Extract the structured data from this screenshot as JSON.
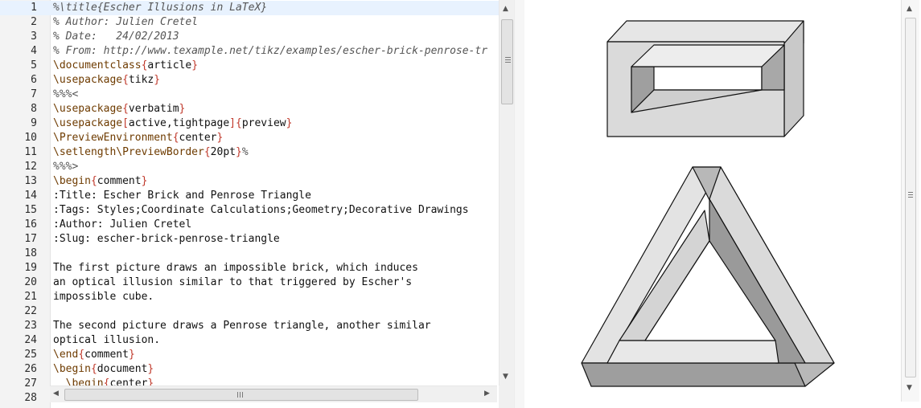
{
  "editor": {
    "lines": [
      {
        "n": "1",
        "parts": [
          [
            "c",
            "%\\title{Escher Illusions in LaTeX}"
          ]
        ]
      },
      {
        "n": "2",
        "parts": [
          [
            "c",
            "% Author: Julien Cretel"
          ]
        ]
      },
      {
        "n": "3",
        "parts": [
          [
            "c",
            "% Date:   24/02/2013"
          ]
        ]
      },
      {
        "n": "4",
        "parts": [
          [
            "c",
            "% From: http://www.texample.net/tikz/examples/escher-brick-penrose-tr"
          ]
        ]
      },
      {
        "n": "5",
        "parts": [
          [
            "k",
            "\\documentclass"
          ],
          [
            "b",
            "{"
          ],
          [
            "t",
            "article"
          ],
          [
            "b",
            "}"
          ]
        ]
      },
      {
        "n": "6",
        "parts": [
          [
            "k",
            "\\usepackage"
          ],
          [
            "b",
            "{"
          ],
          [
            "t",
            "tikz"
          ],
          [
            "b",
            "}"
          ]
        ]
      },
      {
        "n": "7",
        "parts": [
          [
            "c",
            "%%%<"
          ]
        ]
      },
      {
        "n": "8",
        "parts": [
          [
            "k",
            "\\usepackage"
          ],
          [
            "b",
            "{"
          ],
          [
            "t",
            "verbatim"
          ],
          [
            "b",
            "}"
          ]
        ]
      },
      {
        "n": "9",
        "parts": [
          [
            "k",
            "\\usepackage"
          ],
          [
            "b",
            "["
          ],
          [
            "t",
            "active,tightpage"
          ],
          [
            "b",
            "]{"
          ],
          [
            "t",
            "preview"
          ],
          [
            "b",
            "}"
          ]
        ]
      },
      {
        "n": "10",
        "parts": [
          [
            "k",
            "\\PreviewEnvironment"
          ],
          [
            "b",
            "{"
          ],
          [
            "t",
            "center"
          ],
          [
            "b",
            "}"
          ]
        ]
      },
      {
        "n": "11",
        "parts": [
          [
            "k",
            "\\setlength\\PreviewBorder"
          ],
          [
            "b",
            "{"
          ],
          [
            "t",
            "20pt"
          ],
          [
            "b",
            "}"
          ],
          [
            "c",
            "%"
          ]
        ]
      },
      {
        "n": "12",
        "parts": [
          [
            "c",
            "%%%>"
          ]
        ]
      },
      {
        "n": "13",
        "parts": [
          [
            "k",
            "\\begin"
          ],
          [
            "b",
            "{"
          ],
          [
            "t",
            "comment"
          ],
          [
            "b",
            "}"
          ]
        ]
      },
      {
        "n": "14",
        "parts": [
          [
            "t",
            ":Title: Escher Brick and Penrose Triangle"
          ]
        ]
      },
      {
        "n": "15",
        "parts": [
          [
            "t",
            ":Tags: Styles;Coordinate Calculations;Geometry;Decorative Drawings"
          ]
        ]
      },
      {
        "n": "16",
        "parts": [
          [
            "t",
            ":Author: Julien Cretel"
          ]
        ]
      },
      {
        "n": "17",
        "parts": [
          [
            "t",
            ":Slug: escher-brick-penrose-triangle"
          ]
        ]
      },
      {
        "n": "18",
        "parts": [
          [
            "t",
            ""
          ]
        ]
      },
      {
        "n": "19",
        "parts": [
          [
            "t",
            "The first picture draws an impossible brick, which induces"
          ]
        ]
      },
      {
        "n": "20",
        "parts": [
          [
            "t",
            "an optical illusion similar to that triggered by Escher's"
          ]
        ]
      },
      {
        "n": "21",
        "parts": [
          [
            "t",
            "impossible cube."
          ]
        ]
      },
      {
        "n": "22",
        "parts": [
          [
            "t",
            ""
          ]
        ]
      },
      {
        "n": "23",
        "parts": [
          [
            "t",
            "The second picture draws a Penrose triangle, another similar"
          ]
        ]
      },
      {
        "n": "24",
        "parts": [
          [
            "t",
            "optical illusion."
          ]
        ]
      },
      {
        "n": "25",
        "parts": [
          [
            "k",
            "\\end"
          ],
          [
            "b",
            "{"
          ],
          [
            "t",
            "comment"
          ],
          [
            "b",
            "}"
          ]
        ]
      },
      {
        "n": "26",
        "parts": [
          [
            "k",
            "\\begin"
          ],
          [
            "b",
            "{"
          ],
          [
            "t",
            "document"
          ],
          [
            "b",
            "}"
          ]
        ]
      },
      {
        "n": "27",
        "parts": [
          [
            "k",
            "  \\begin"
          ],
          [
            "b",
            "{"
          ],
          [
            "t",
            "center"
          ],
          [
            "b",
            "}"
          ]
        ]
      },
      {
        "n": "28",
        "parts": [
          [
            "t",
            ""
          ]
        ]
      }
    ]
  },
  "colors": {
    "current_line": "#e8f2fe",
    "comment": "#555555",
    "command": "#6e3b00",
    "brace": "#c0392b",
    "light_face": "#e6e6e6",
    "mid_face": "#c9c9c9",
    "dark_face": "#9f9f9f"
  },
  "icons": {
    "up": "▲",
    "down": "▼",
    "left": "◀",
    "right": "▶"
  }
}
